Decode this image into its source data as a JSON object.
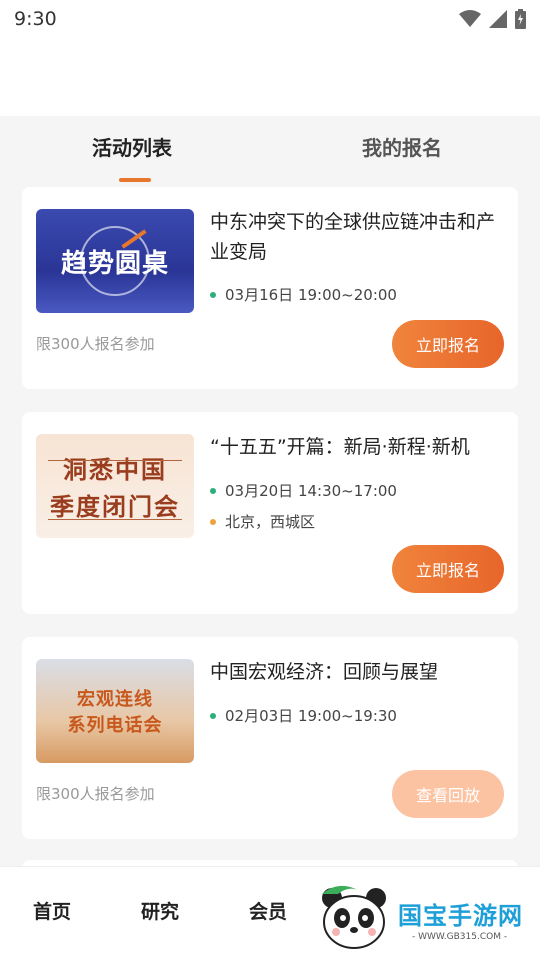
{
  "status": {
    "time": "9:30"
  },
  "tabs": [
    {
      "label": "活动列表",
      "active": true
    },
    {
      "label": "我的报名",
      "active": false
    }
  ],
  "events": [
    {
      "thumbnail_text": [
        "趋势圆桌"
      ],
      "title": "中东冲突下的全球供应链冲击和产业变局",
      "time": "03月16日 19:00~20:00",
      "limit": "限300人报名参加",
      "button": "立即报名"
    },
    {
      "thumbnail_text": [
        "洞悉中国",
        "季度闭门会"
      ],
      "title": "“十五五”开篇：新局·新程·新机",
      "time": "03月20日 14:30~17:00",
      "location": "北京，西城区",
      "button": "立即报名"
    },
    {
      "thumbnail_text": [
        "宏观连线",
        "系列电话会"
      ],
      "title": "中国宏观经济：回顾与展望",
      "time": "02月03日 19:00~19:30",
      "limit": "限300人报名参加",
      "button": "查看回放"
    }
  ],
  "bottom_nav": [
    "首页",
    "研究",
    "会员"
  ],
  "watermark": {
    "name": "国宝手游网",
    "url": "- WWW.GB315.COM -"
  },
  "colors": {
    "accent": "#e8772e",
    "dot_time": "#2bb07a",
    "dot_location": "#f0a23a",
    "button_disabled": "#fcc3a3"
  }
}
